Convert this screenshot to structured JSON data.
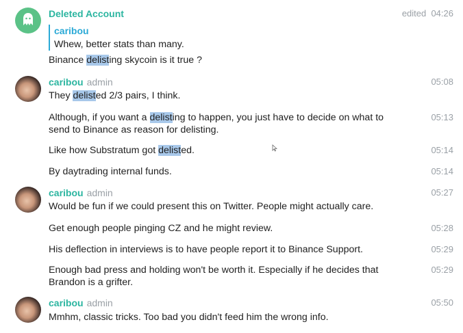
{
  "messages": [
    {
      "author": "Deleted Account",
      "time": "edited  04:26",
      "quote_author": "caribou",
      "quote_text": "Whew, better stats than many.",
      "text_parts": [
        "Binance ",
        "delist",
        "ing skycoin is it true ?"
      ]
    },
    {
      "author": "caribou",
      "role": "admin",
      "time": "05:08",
      "text_parts": [
        "They ",
        "delist",
        "ed 2/3 pairs, I think."
      ]
    },
    {
      "time": "05:13",
      "text_parts": [
        "Although, if you want a ",
        "delist",
        "ing to happen, you just have to decide on what to send to Binance as reason for delisting."
      ]
    },
    {
      "time": "05:14",
      "text_parts": [
        "Like how Substratum got ",
        "delist",
        "ed."
      ]
    },
    {
      "time": "05:14",
      "text": "By daytrading internal funds."
    },
    {
      "author": "caribou",
      "role": "admin",
      "time": "05:27",
      "text": "Would be fun if we could present this on Twitter. People might actually care."
    },
    {
      "time": "05:28",
      "text": "Get enough people pinging CZ and he might review."
    },
    {
      "time": "05:29",
      "text": "His deflection in interviews is to have people report it to Binance Support."
    },
    {
      "time": "05:29",
      "text": "Enough bad press and holding won't be worth it. Especially if he decides that Brandon is a grifter."
    },
    {
      "author": "caribou",
      "role": "admin",
      "time": "05:50",
      "text": "Mmhm, classic tricks. Too bad you didn't feed him the wrong info."
    }
  ],
  "colors": {
    "author_name": "#2bb5a0",
    "quote_accent": "#2aa9d6",
    "highlight": "#a8c8ea",
    "timestamp": "#9aa0a6"
  },
  "icons": {
    "deleted_account_avatar": "ghost-icon",
    "caribou_avatar": "user-photo"
  }
}
